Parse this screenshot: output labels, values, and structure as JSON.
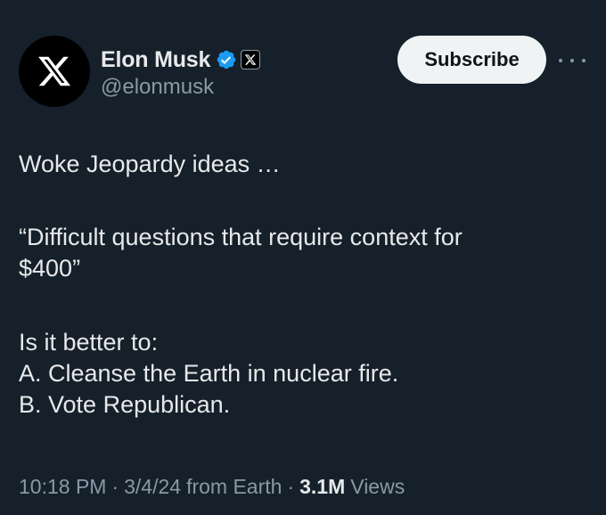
{
  "author": {
    "display_name": "Elon Musk",
    "handle": "@elonmusk",
    "avatar_icon": "x-logo-icon",
    "verified_icon": "verified-badge-icon",
    "verified_color": "#1d9bf0",
    "affiliation_icon": "x-affiliation-icon"
  },
  "actions": {
    "subscribe_label": "Subscribe",
    "more_icon": "more-dots-icon"
  },
  "tweet": {
    "line1": "Woke Jeopardy ideas …",
    "line2": "“Difficult questions that require context for\n$400”",
    "line3": "Is it better to:\nA. Cleanse the Earth in nuclear fire.\nB. Vote Republican."
  },
  "meta": {
    "time": "10:18 PM",
    "date": "3/4/24",
    "source": "from Earth",
    "separator": "·",
    "views_count": "3.1M",
    "views_label": "Views"
  },
  "colors": {
    "background": "#15202b",
    "text": "#e7e9ea",
    "muted": "#8b98a5",
    "button_bg": "#eff3f4"
  }
}
